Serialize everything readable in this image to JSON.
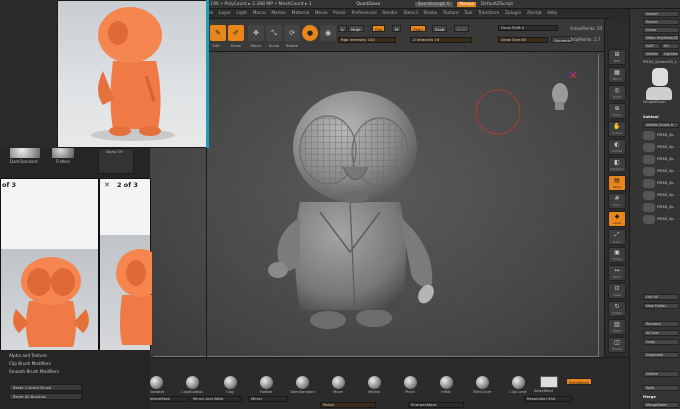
{
  "topbar": {
    "info": "0.196 • PolyCount ▸ 2.388 MP • MeshCount ▸ 1",
    "quicksave": "QuickSave",
    "seethrough": "See-through 0",
    "menus": "Menus",
    "script": "DefaultZScript"
  },
  "menubar": [
    "File",
    "Layer",
    "Light",
    "Macro",
    "Marker",
    "Material",
    "Movie",
    "Picker",
    "Preferences",
    "Render",
    "Stencil",
    "Stroke",
    "Texture",
    "Tool",
    "Transform",
    "Zplugin",
    "Zscript",
    "Help"
  ],
  "toolbar": {
    "edit": "Edit",
    "draw": "Draw",
    "move": "Move",
    "scale": "Scale",
    "rotate": "Rotate",
    "a_label": "A",
    "mrgb": "Mrgb",
    "rgb": "Rgb",
    "m": "M",
    "zadd": "Zadd",
    "zsub": "Zsub",
    "zcut": "Zcut",
    "rgb_intensity": "Rgb Intensity 100",
    "z_intensity": "Z Intensity 16",
    "focal_shift": "Focal Shift 0",
    "draw_size": "Draw Size 65",
    "dynamic": "Dynamic",
    "active_points": "ActivePoints: 20",
    "total_points": "TotalPoints: 2.7"
  },
  "righttools": [
    {
      "g": "⊞",
      "l": "BPR"
    },
    {
      "g": "▦",
      "l": "SPix 3"
    },
    {
      "g": "◎",
      "l": "Scroll"
    },
    {
      "g": "⊕",
      "l": "Zoom"
    },
    {
      "g": "✋",
      "l": "Actual"
    },
    {
      "g": "◐",
      "l": "AAHalf"
    },
    {
      "g": "◧",
      "l": "Dynamic"
    },
    {
      "g": "▤",
      "l": "Persp"
    },
    {
      "g": "#",
      "l": "Floor"
    },
    {
      "g": "◆",
      "l": "Local"
    },
    {
      "g": "⤢",
      "l": "Gxyz"
    },
    {
      "g": "▣",
      "l": "Frame"
    },
    {
      "g": "↔",
      "l": "Move"
    },
    {
      "g": "⊡",
      "l": "Scale"
    },
    {
      "g": "↻",
      "l": "Rotate"
    },
    {
      "g": "▥",
      "l": "PolyF"
    },
    {
      "g": "◫",
      "l": "Transp"
    },
    {
      "g": "◑",
      "l": "Ghost"
    },
    {
      "g": "▢",
      "l": "Solo"
    },
    {
      "g": "✕",
      "l": "Xpose"
    }
  ],
  "rightpanel": {
    "import": "Import",
    "export": "Export",
    "clone": "Clone",
    "make": "Make PolyMesh3D",
    "goz": "GoZ",
    "all": "All",
    "visible": "Visible",
    "lightbox": "Lightbox▸Tools",
    "tool_name": "PM3D_Sphere3D_1",
    "simple_brush": "SimpleBrush",
    "subtool_header": "Subtool",
    "visible_count": "Visible Count 9",
    "subtools": [
      "PM3D_Sp",
      "PM3D_Sp",
      "PM3D_Sp",
      "PM3D_Sp",
      "PM3D_Sp",
      "PM3D_Sp",
      "PM3D_Sp",
      "PM3D_Sp"
    ],
    "list_all": "List All",
    "new_folder": "New Folder",
    "rename": "Rename",
    "all_low": "All Low",
    "copy": "Copy",
    "duplicate": "Duplicate",
    "delete": "Delete",
    "split": "Split",
    "merge": "Merge",
    "merge_down": "MergeDown"
  },
  "bottombar": [
    {
      "l": "Standard"
    },
    {
      "l": "ClayBuildup"
    },
    {
      "l": "Clay"
    },
    {
      "l": "Flatten"
    },
    {
      "l": "DamStandard"
    },
    {
      "l": "Move"
    },
    {
      "l": "hPolish"
    },
    {
      "l": "Pinch"
    },
    {
      "l": "Inflat"
    },
    {
      "l": "TrimCurve"
    },
    {
      "l": "ClipCurve"
    }
  ],
  "bottom_extra": {
    "backface": "BackfaceMask",
    "mirror_weld": "Mirror And Weld",
    "mirror": "Mirror",
    "polish": "Polish",
    "sharpen": "SharpenMask",
    "selectrect": "SelectRect",
    "resolution": "Resolution 904",
    "dynamesh": "DynaMesh"
  },
  "overlay": {
    "photo2_title": "of 3",
    "photo3_title": "2 of 3",
    "close": "✕"
  },
  "leftlower": {
    "damstandard": "DamStandard",
    "flatten": "Flatten",
    "alpha_off": "Alpha Off",
    "alpha_texture": "Alpha and Texture",
    "clip_modifiers": "Clip Brush Modifiers",
    "smooth_modifiers": "Smooth Brush Modifiers",
    "reset_current": "Reset Current Brush",
    "reset_all": "Reset All Brushes"
  },
  "colors": {
    "accent": "#e8861c",
    "model": "#8a8a8a",
    "toy": "#f07a45",
    "frame_accent": "#1aa1b8"
  }
}
